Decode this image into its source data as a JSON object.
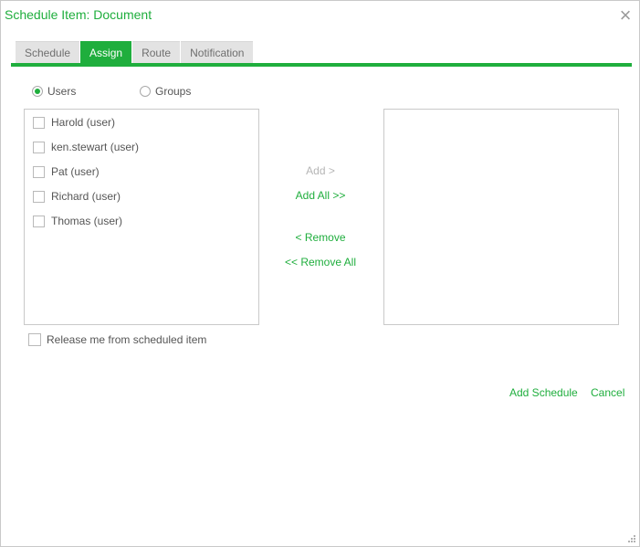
{
  "dialog": {
    "title": "Schedule Item: Document",
    "close_glyph": "×"
  },
  "tabs": [
    {
      "label": "Schedule",
      "active": false
    },
    {
      "label": "Assign",
      "active": true
    },
    {
      "label": "Route",
      "active": false
    },
    {
      "label": "Notification",
      "active": false
    }
  ],
  "assign": {
    "type_options": [
      {
        "label": "Users",
        "selected": true
      },
      {
        "label": "Groups",
        "selected": false
      }
    ],
    "available": [
      {
        "label": "Harold (user)",
        "checked": false
      },
      {
        "label": "ken.stewart (user)",
        "checked": false
      },
      {
        "label": "Pat (user)",
        "checked": false
      },
      {
        "label": "Richard (user)",
        "checked": false
      },
      {
        "label": "Thomas (user)",
        "checked": false
      }
    ],
    "selected": [],
    "buttons": {
      "add": "Add >",
      "add_all": "Add All >>",
      "remove": "< Remove",
      "remove_all": "<< Remove All"
    },
    "release_label": "Release me from scheduled item"
  },
  "footer": {
    "add_schedule": "Add Schedule",
    "cancel": "Cancel"
  },
  "colors": {
    "accent": "#1fae3d",
    "disabled": "#b5b5b5",
    "tab_inactive": "#e3e3e3"
  },
  "icons": {
    "close": "close-icon",
    "resize": "resize-grip-icon"
  }
}
